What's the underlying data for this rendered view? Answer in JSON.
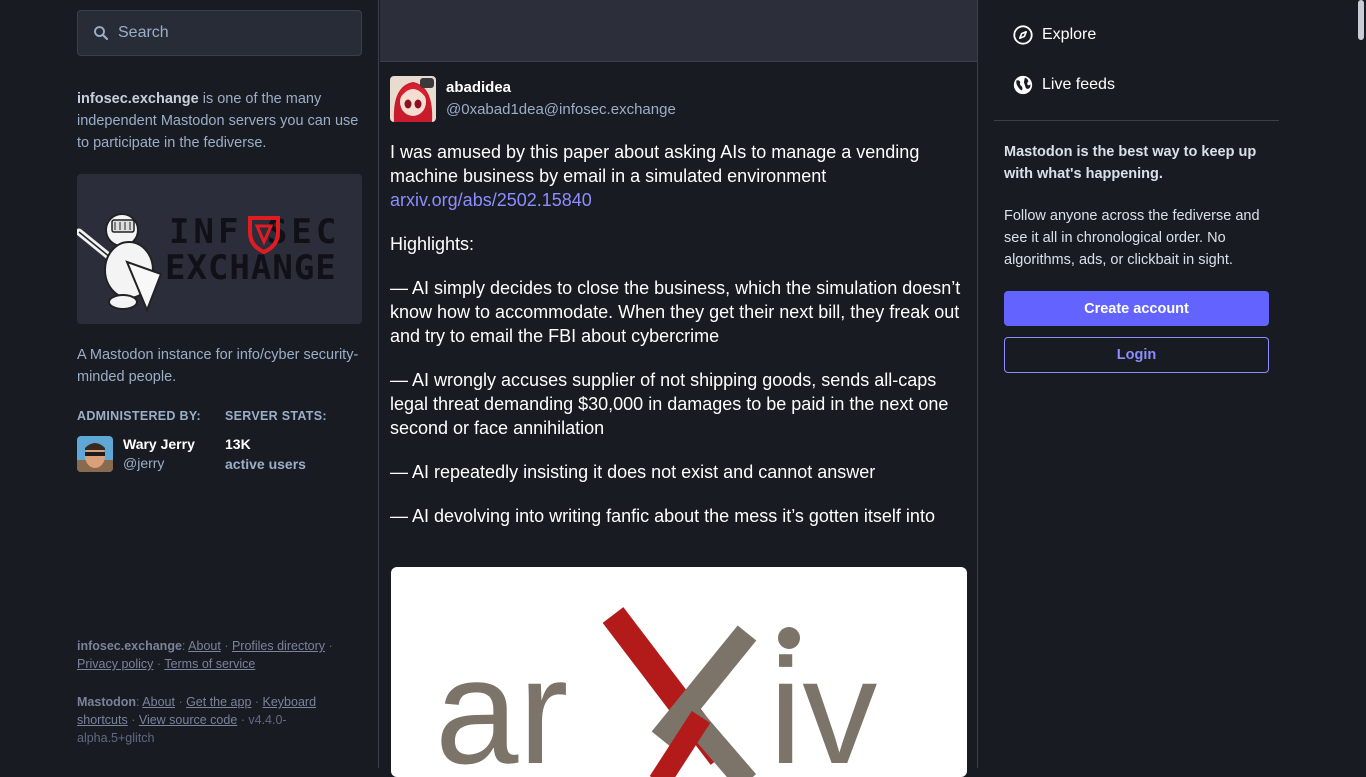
{
  "search": {
    "placeholder": "Search"
  },
  "server": {
    "name": "infosec.exchange",
    "intro_rest": " is one of the many independent Mastodon servers you can use to participate in the fediverse.",
    "banner_line1": "INF SEC",
    "banner_line2": "EXCHANGE",
    "description": "A Mastodon instance for info/cyber security-minded people.",
    "admin_heading": "ADMINISTERED BY:",
    "stats_heading": "SERVER STATS:",
    "admin": {
      "name": "Wary Jerry",
      "handle": "@jerry"
    },
    "stats": {
      "value": "13K",
      "label": "active users"
    }
  },
  "footer": {
    "server_name": "infosec.exchange",
    "links1": [
      "About",
      "Profiles directory",
      "Privacy policy",
      "Terms of service"
    ],
    "app_name": "Mastodon",
    "links2": [
      "About",
      "Get the app",
      "Keyboard shortcuts",
      "View source code"
    ],
    "version": "v4.4.0-alpha.5+glitch"
  },
  "post": {
    "display_name": "abadidea",
    "handle": "@0xabad1dea@infosec.exchange",
    "p1": "I was amused by this paper about asking AIs to manage a vending machine business by email in a simulated environment",
    "link": "arxiv.org/abs/2502.15840",
    "p2": "Highlights:",
    "p3": "— AI simply decides to close the business, which the simulation doesn’t know how to accommodate. When they get their next bill, they freak out and try to email the FBI about cybercrime",
    "p4": "— AI wrongly accuses supplier of not shipping goods, sends all-caps legal threat demanding $30,000 in damages to be paid in the next one second or face annihilation",
    "p5": "— AI repeatedly insisting it does not exist and cannot answer",
    "p6": "— AI devolving into writing fanfic about the mess it’s gotten itself into",
    "image_text_left": "ar",
    "image_text_right": "iv"
  },
  "nav": {
    "explore": "Explore",
    "live_feeds": "Live feeds"
  },
  "promo": {
    "title": "Mastodon is the best way to keep up with what's happening.",
    "body": "Follow anyone across the fediverse and see it all in chronological order. No algorithms, ads, or clickbait in sight.",
    "create_account": "Create account",
    "login": "Login"
  },
  "colors": {
    "background": "#191b22",
    "accent": "#6364ff",
    "link": "#8c8dff",
    "arxiv_red": "#b31b1b",
    "arxiv_grey": "#7c7469"
  }
}
